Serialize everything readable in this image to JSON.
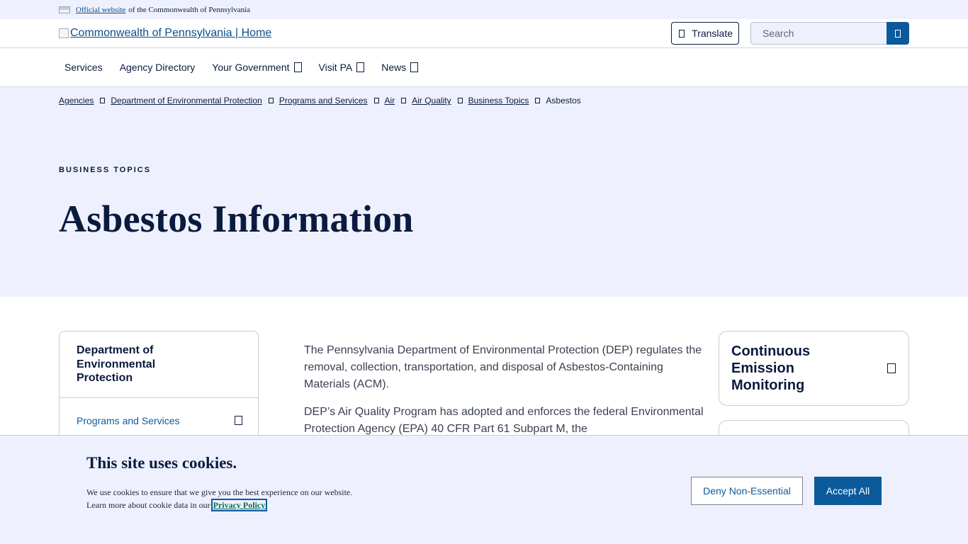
{
  "official_bar": {
    "link_text": "Official website",
    "suffix_text": "of the Commonwealth of Pennsylvania"
  },
  "header": {
    "logo_alt": "Commonwealth of Pennsylvania | Home",
    "translate_label": "Translate",
    "search_placeholder": "Search"
  },
  "main_nav": {
    "items": [
      {
        "label": "Services",
        "has_dropdown": false
      },
      {
        "label": "Agency Directory",
        "has_dropdown": false
      },
      {
        "label": "Your Government",
        "has_dropdown": true
      },
      {
        "label": "Visit PA",
        "has_dropdown": true
      },
      {
        "label": "News",
        "has_dropdown": true
      }
    ]
  },
  "breadcrumb": {
    "items": [
      "Agencies",
      "Department of Environmental Protection",
      "Programs and Services",
      "Air",
      "Air Quality",
      "Business Topics"
    ],
    "current": "Asbestos"
  },
  "hero": {
    "eyebrow": "BUSINESS TOPICS",
    "title": "Asbestos Information"
  },
  "sidenav": {
    "title": "Department of Environmental Protection",
    "items": [
      {
        "label": "Programs and Services"
      }
    ]
  },
  "body": {
    "paragraphs": [
      "The Pennsylvania Department of Environmental Protection (DEP) regulates the removal, collection, transportation, and disposal of Asbestos-Containing Materials (ACM).",
      "DEP’s Air Quality Program has adopted and enforces the federal Environmental Protection Agency (EPA) 40 CFR Part 61 Subpart M, the"
    ]
  },
  "related_cards": {
    "items": [
      {
        "title": "Continuous Emission Monitoring"
      }
    ]
  },
  "cookie_banner": {
    "title": "This site uses cookies.",
    "line1": "We use cookies to ensure that we give you the best experience on our website.",
    "line2": "Learn more about cookie data in our",
    "privacy_link": "Privacy Policy",
    "deny_label": "Deny Non-Essential",
    "accept_label": "Accept All"
  },
  "colors": {
    "navy": "#0b1b3f",
    "link_blue": "#0b5a9c",
    "hero_bg": "#eef1fd"
  }
}
